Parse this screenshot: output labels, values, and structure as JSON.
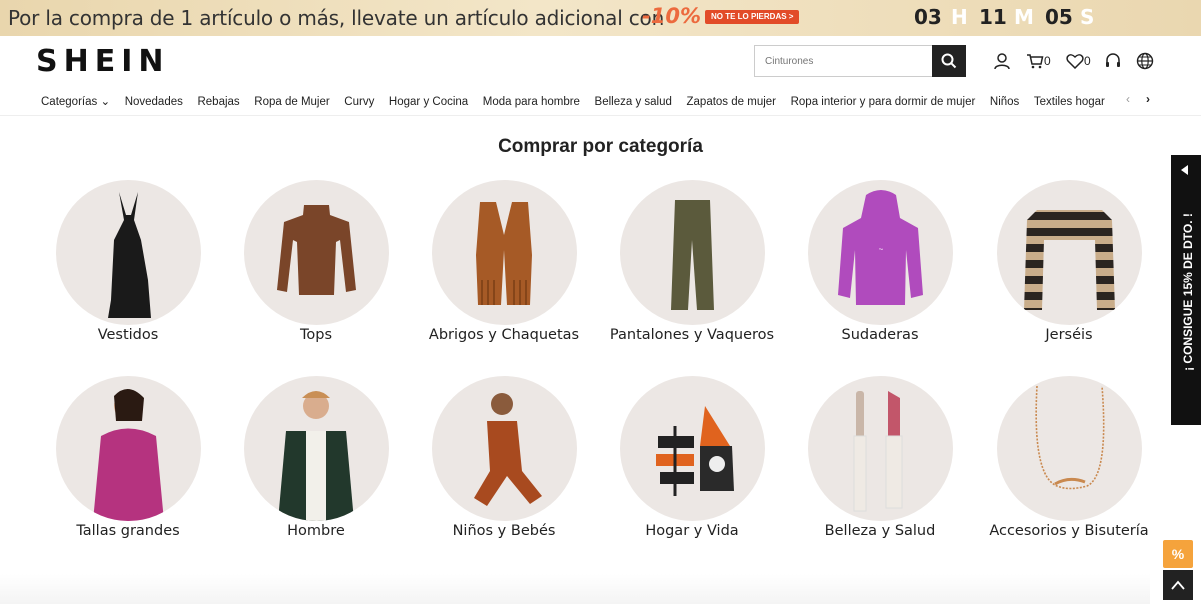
{
  "promo": {
    "text": "Por la compra de 1 artículo o más,  llevate un artículo adicional con",
    "percent": "-10%",
    "cta": "NO TE LO PIERDAS >",
    "countdown": {
      "hours": "03",
      "h": "H",
      "minutes": "11",
      "m": "M",
      "seconds": "05",
      "s": "S"
    }
  },
  "header": {
    "logo": "SHEIN",
    "search_placeholder": "Cinturones",
    "cart_count": "0",
    "wishlist_count": "0"
  },
  "nav": {
    "items": [
      "Categorías ⌄",
      "Novedades",
      "Rebajas",
      "Ropa de Mujer",
      "Curvy",
      "Hogar y Cocina",
      "Moda para hombre",
      "Belleza y salud",
      "Zapatos de mujer",
      "Ropa interior y para dormir de mujer",
      "Niños",
      "Textiles hogar"
    ],
    "prev": "‹",
    "next": "›"
  },
  "section": {
    "title": "Comprar por categoría",
    "categories": [
      {
        "label": "Vestidos"
      },
      {
        "label": "Tops"
      },
      {
        "label": "Abrigos y Chaquetas"
      },
      {
        "label": "Pantalones y Vaqueros"
      },
      {
        "label": "Sudaderas"
      },
      {
        "label": "Jerséis"
      },
      {
        "label": "Tallas grandes"
      },
      {
        "label": "Hombre"
      },
      {
        "label": "Niños y Bebés"
      },
      {
        "label": "Hogar y Vida"
      },
      {
        "label": "Belleza y Salud"
      },
      {
        "label": "Accesorios y Bisutería"
      }
    ]
  },
  "side_tab": {
    "text": "¡ CONSIGUE 15% DE DTO. !"
  },
  "discount_badge": "%"
}
